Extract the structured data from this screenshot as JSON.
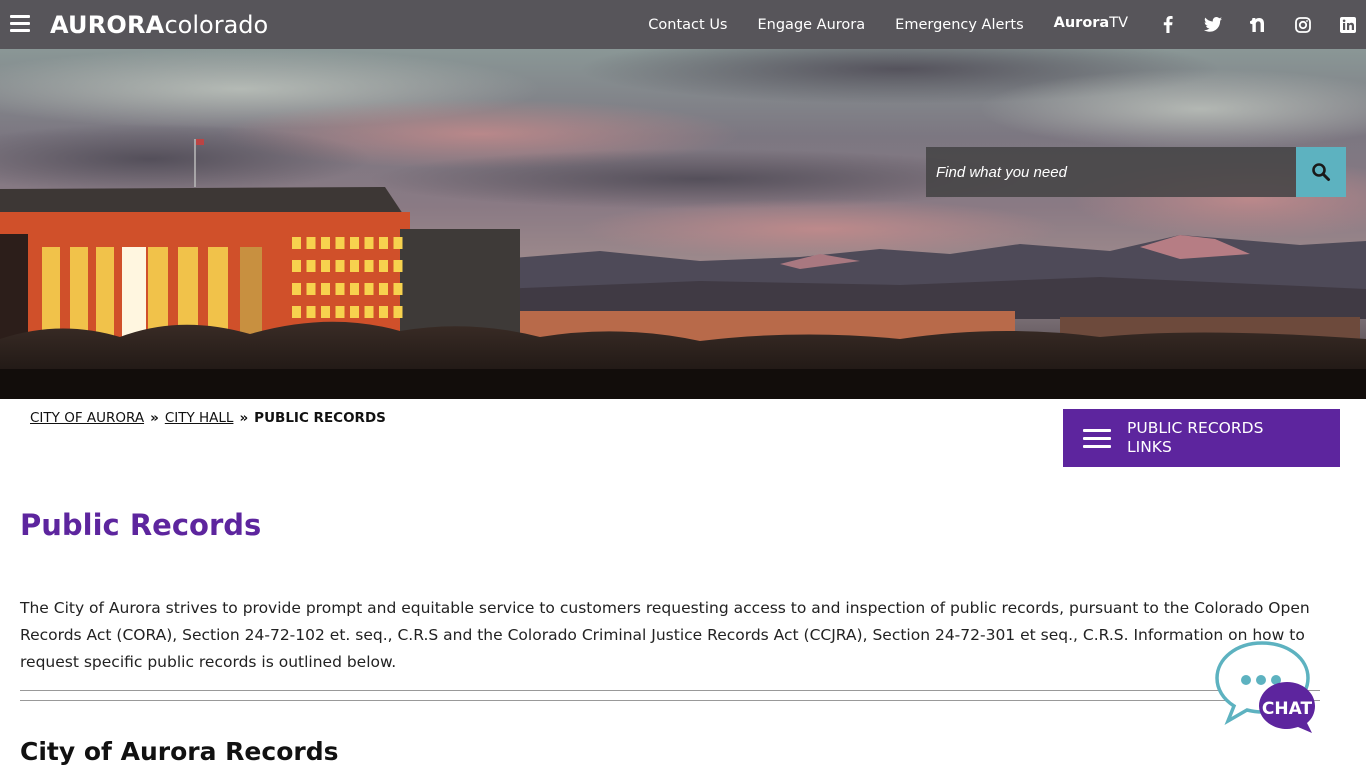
{
  "header": {
    "menu_icon": "hamburger-icon",
    "logo_bold": "AURORA",
    "logo_light": "colorado",
    "nav": [
      {
        "label": "Contact Us"
      },
      {
        "label": "Engage Aurora"
      },
      {
        "label": "Emergency Alerts"
      }
    ],
    "auroratv_bold": "Aurora",
    "auroratv_light": "TV",
    "social": [
      {
        "name": "facebook",
        "icon": "facebook-icon"
      },
      {
        "name": "twitter",
        "icon": "twitter-icon"
      },
      {
        "name": "nextdoor",
        "icon": "nextdoor-icon"
      },
      {
        "name": "instagram",
        "icon": "instagram-icon"
      },
      {
        "name": "linkedin",
        "icon": "linkedin-icon"
      }
    ]
  },
  "hero": {
    "image_description": "Aurora municipal center at sunset with mountains"
  },
  "search": {
    "placeholder": "Find what you need",
    "value": "",
    "button_icon": "search-icon"
  },
  "breadcrumb": {
    "items": [
      {
        "label": "CITY OF AURORA"
      },
      {
        "label": "CITY HALL"
      }
    ],
    "separator": "»",
    "current": "PUBLIC RECORDS"
  },
  "links_button": {
    "label": "PUBLIC RECORDS LINKS",
    "icon": "hamburger-icon"
  },
  "content": {
    "title": "Public Records",
    "intro": "The City of Aurora strives to provide prompt and equitable service to customers requesting access to and inspection of public records, pursuant to the Colorado Open Records Act (CORA), Section 24-72-102 et. seq., C.R.S and the Colorado Criminal Justice Records Act (CCJRA), Section 24-72-301 et seq., C.R.S.  Information on how to request specific public records is outlined below.",
    "section_heading": "City of Aurora Records"
  },
  "chat": {
    "label": "CHAT"
  },
  "colors": {
    "header_bg": "#57555a",
    "brand_purple": "#5d259e",
    "search_button": "#5db2c0",
    "chat_teal": "#5db2c0"
  }
}
